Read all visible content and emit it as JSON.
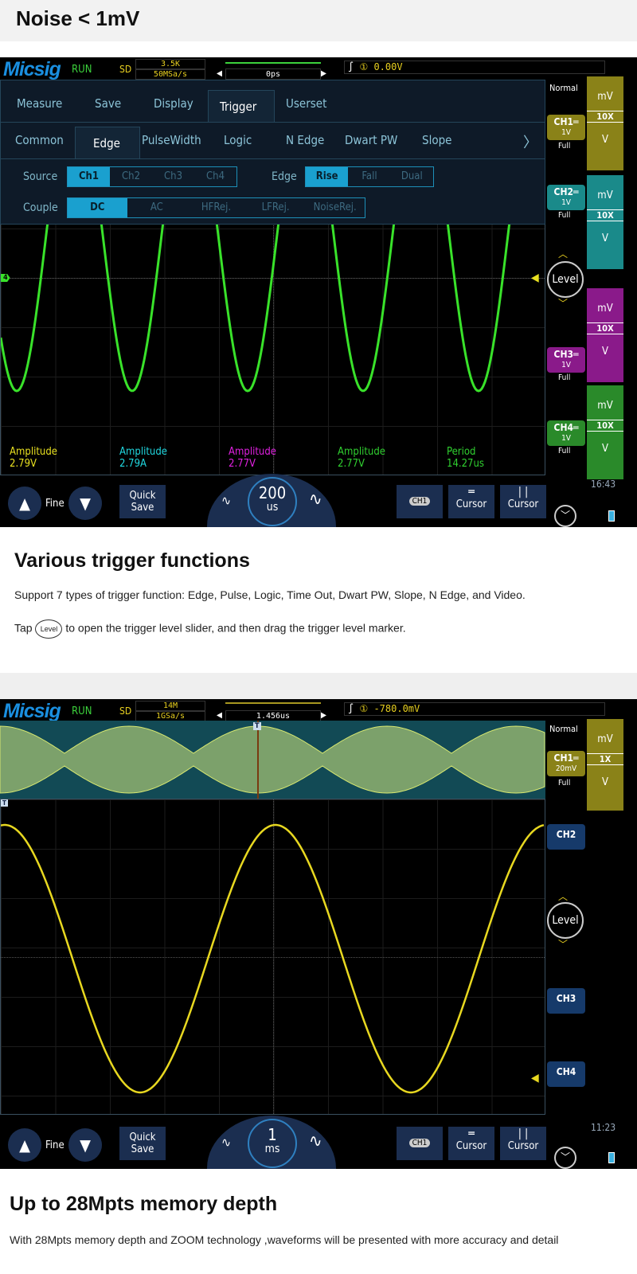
{
  "section1": {
    "title": "Noise < 1mV"
  },
  "scope1": {
    "logo": "Micsig",
    "run": "RUN",
    "sd": "SD",
    "depth": "3.5K",
    "rate": "50MSa/s",
    "time_offset": "0ps",
    "trigger_value": "0.00V",
    "trigger_src": "①",
    "menu_tabs": [
      "Measure",
      "Save",
      "Display",
      "Trigger",
      "Userset"
    ],
    "active_tab": "Trigger",
    "trigger_types": [
      "Common",
      "Edge",
      "PulseWidth",
      "Logic",
      "N Edge",
      "Dwart PW",
      "Slope"
    ],
    "active_type": "Edge",
    "more": "〉",
    "source_label": "Source",
    "sources": [
      "Ch1",
      "Ch2",
      "Ch3",
      "Ch4"
    ],
    "edge_label": "Edge",
    "edges": [
      "Rise",
      "Fall",
      "Dual"
    ],
    "couple_label": "Couple",
    "couples": [
      "DC",
      "AC",
      "HFRej.",
      "LFRej.",
      "NoiseRej."
    ],
    "mode": "Normal",
    "channels": [
      {
        "name": "CH1",
        "scale": "1V",
        "bw": "Full",
        "probe": "10X",
        "color": "#8a8218"
      },
      {
        "name": "CH2",
        "scale": "1V",
        "bw": "Full",
        "probe": "10X",
        "color": "#1a8a8a"
      },
      {
        "name": "CH3",
        "scale": "1V",
        "bw": "Full",
        "probe": "10X",
        "color": "#8a1a8a"
      },
      {
        "name": "CH4",
        "scale": "1V",
        "bw": "Full",
        "probe": "10X",
        "color": "#2a8a2a"
      }
    ],
    "unit_mv": "mV",
    "unit_v": "V",
    "level": "Level",
    "marker": "4",
    "measurements": [
      {
        "label": "Amplitude",
        "value": "2.79V",
        "color": "#e8e020"
      },
      {
        "label": "Amplitude",
        "value": "2.79A",
        "color": "#20d8e0"
      },
      {
        "label": "Amplitude",
        "value": "2.77V",
        "color": "#e020e0"
      },
      {
        "label": "Amplitude",
        "value": "2.77V",
        "color": "#30d030"
      },
      {
        "label": "Period",
        "value": "14.27us",
        "color": "#30d030"
      }
    ],
    "fine": "Fine",
    "quick_save": [
      "Quick",
      "Save"
    ],
    "timebase": "200",
    "timebase_unit": "us",
    "ch_btn": "CH1",
    "cursor": "Cursor",
    "clock": "16:43",
    "wave_color": "#39e22a"
  },
  "section2": {
    "title": "Various trigger functions",
    "desc": "Support 7 types of trigger function: Edge, Pulse, Logic, Time Out, Dwart PW, Slope, N Edge, and Video.",
    "tap": "Tap",
    "level_icon": "Level",
    "tap_rest": "to open the trigger level slider, and then drag the trigger level marker."
  },
  "scope2": {
    "logo": "Micsig",
    "run": "RUN",
    "sd": "SD",
    "depth": "14M",
    "rate": "1GSa/s",
    "time_offset": "1.456us",
    "trigger_value": "-780.0mV",
    "trigger_src": "①",
    "mode": "Normal",
    "ch1": {
      "name": "CH1",
      "scale": "20mV",
      "bw": "Full",
      "probe": "1X"
    },
    "unit_mv": "mV",
    "unit_v": "V",
    "ch2": "CH2",
    "ch3": "CH3",
    "ch4": "CH4",
    "level": "Level",
    "t_marker": "T",
    "fine": "Fine",
    "quick_save": [
      "Quick",
      "Save"
    ],
    "timebase": "1",
    "timebase_unit": "ms",
    "ch_btn": "CH1",
    "cursor": "Cursor",
    "clock": "11:23",
    "wave_color": "#e8d820"
  },
  "section3": {
    "title": "Up to 28Mpts memory depth",
    "desc": "With 28Mpts memory depth and ZOOM technology ,waveforms will be presented with more accuracy and detail"
  }
}
